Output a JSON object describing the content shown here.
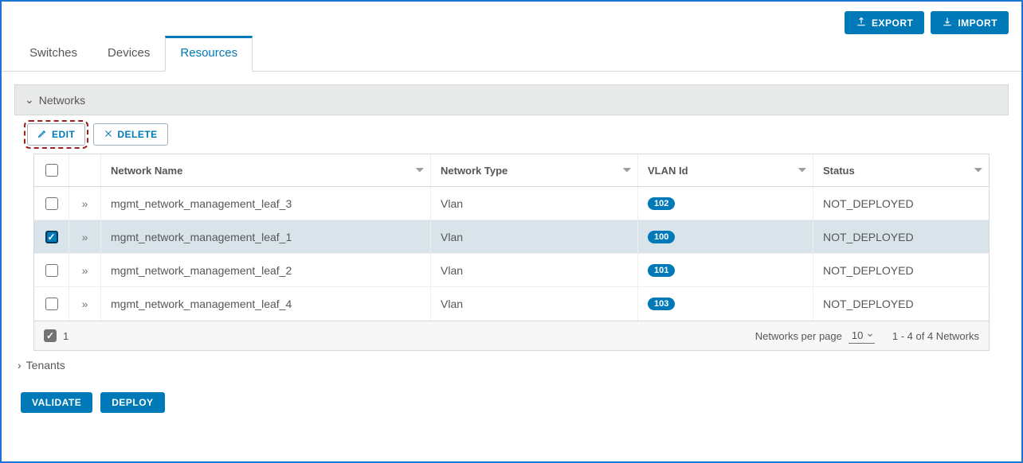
{
  "toolbar": {
    "export": "EXPORT",
    "import": "IMPORT"
  },
  "tabs": {
    "switches": "Switches",
    "devices": "Devices",
    "resources": "Resources"
  },
  "networks": {
    "title": "Networks",
    "edit": "EDIT",
    "delete": "DELETE",
    "columns": {
      "name": "Network Name",
      "type": "Network Type",
      "vlan": "VLAN Id",
      "status": "Status"
    },
    "rows": [
      {
        "selected": false,
        "name": "mgmt_network_management_leaf_3",
        "type": "Vlan",
        "vlan": "102",
        "status": "NOT_DEPLOYED"
      },
      {
        "selected": true,
        "name": "mgmt_network_management_leaf_1",
        "type": "Vlan",
        "vlan": "100",
        "status": "NOT_DEPLOYED"
      },
      {
        "selected": false,
        "name": "mgmt_network_management_leaf_2",
        "type": "Vlan",
        "vlan": "101",
        "status": "NOT_DEPLOYED"
      },
      {
        "selected": false,
        "name": "mgmt_network_management_leaf_4",
        "type": "Vlan",
        "vlan": "103",
        "status": "NOT_DEPLOYED"
      }
    ],
    "footer": {
      "selected_count": "1",
      "per_page_label": "Networks per page",
      "per_page_value": "10",
      "range": "1 - 4 of 4 Networks"
    }
  },
  "tenants": {
    "title": "Tenants"
  },
  "actions": {
    "validate": "VALIDATE",
    "deploy": "DEPLOY"
  }
}
